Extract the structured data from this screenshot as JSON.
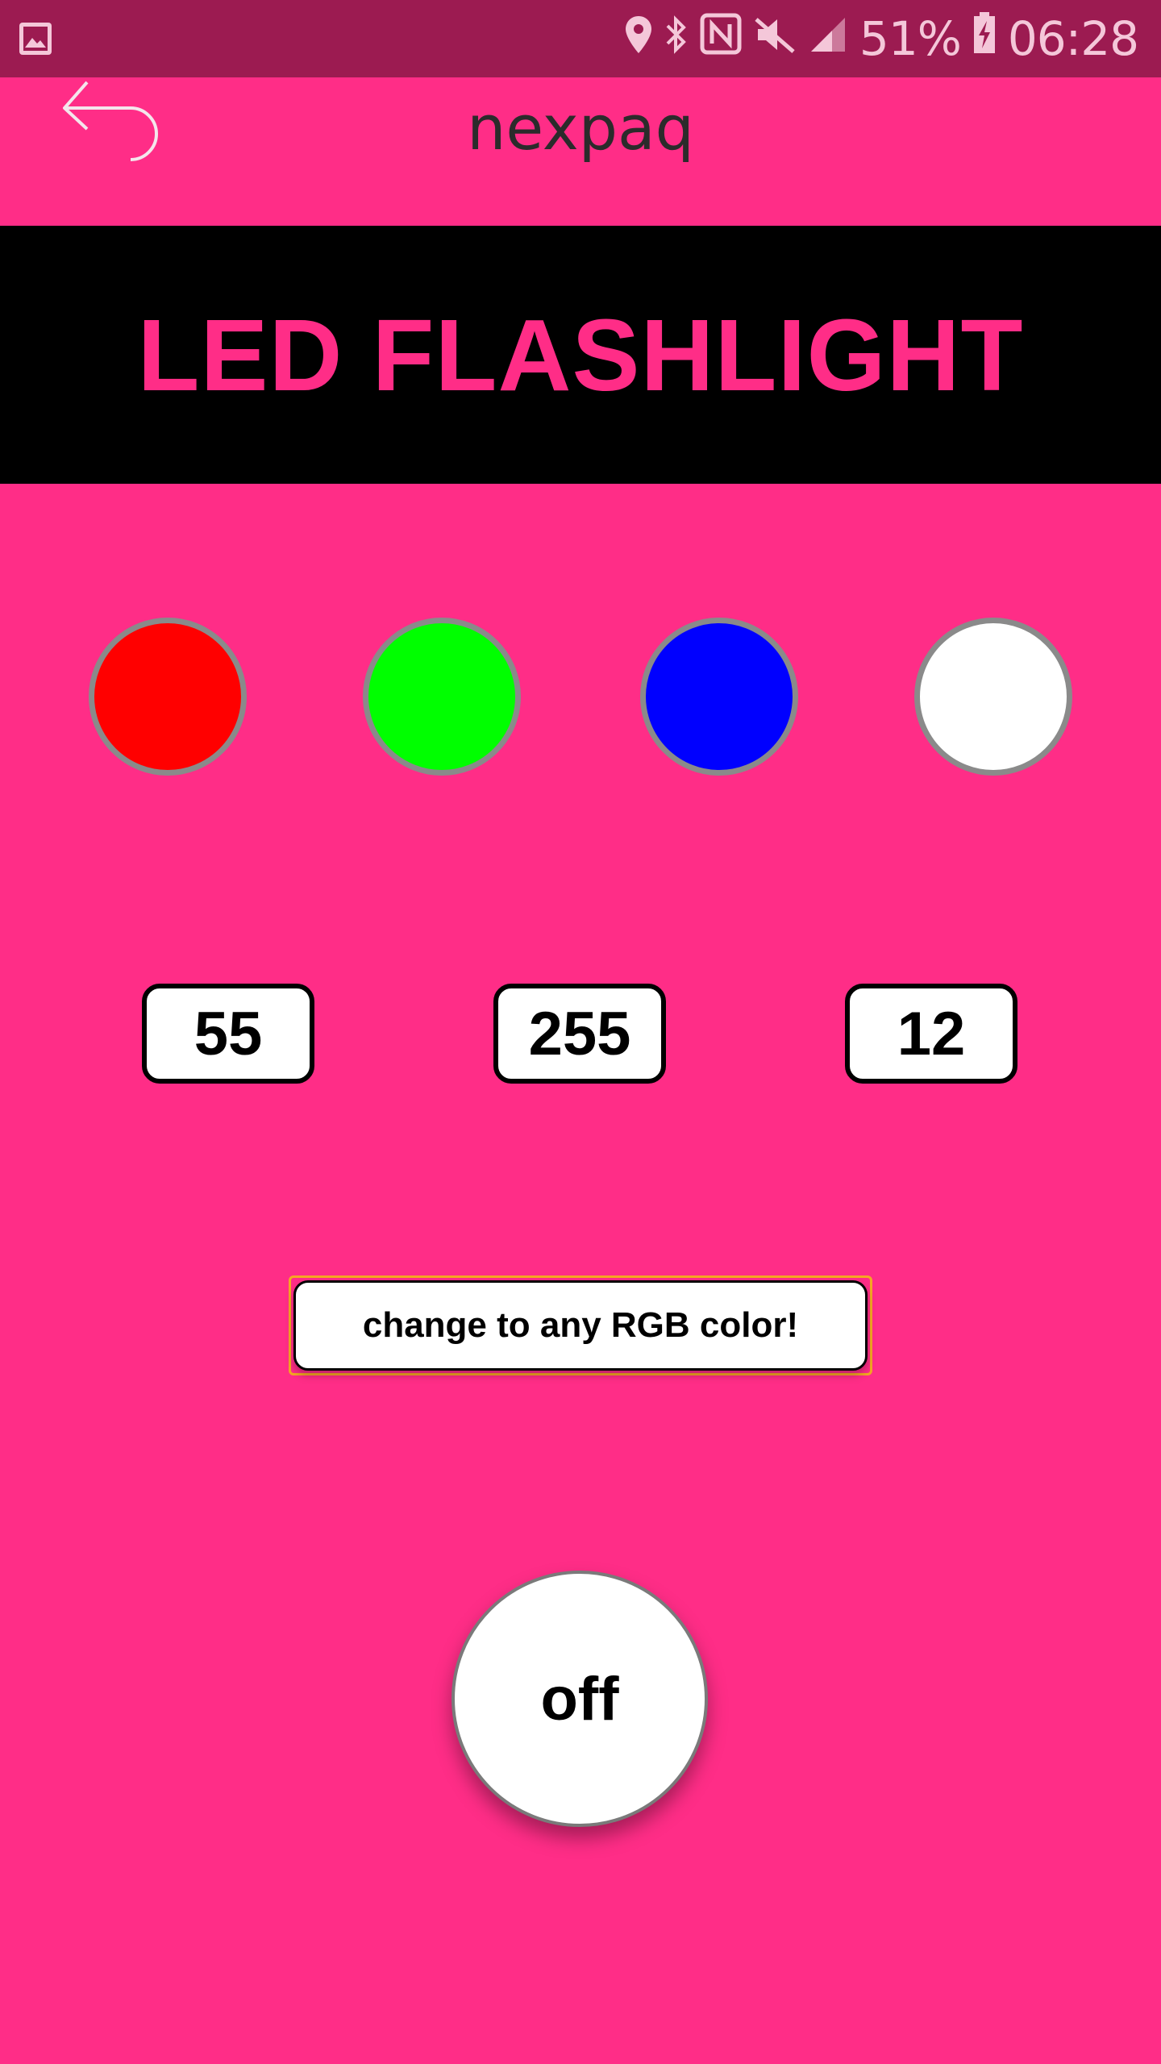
{
  "status_bar": {
    "battery": "51%",
    "time": "06:28",
    "icons": [
      "gallery-icon",
      "location-icon",
      "bluetooth-icon",
      "nfc-icon",
      "mute-icon",
      "signal-icon",
      "battery-charging-icon"
    ]
  },
  "header": {
    "title": "nexpaq",
    "back_icon": "back-arrow-icon"
  },
  "banner": {
    "title": "LED FLASHLIGHT"
  },
  "swatches": [
    {
      "name": "red",
      "color": "#FF0000"
    },
    {
      "name": "green",
      "color": "#00FF00"
    },
    {
      "name": "blue",
      "color": "#0000FF"
    },
    {
      "name": "white",
      "color": "#FFFFFF"
    }
  ],
  "rgb_values": {
    "r": "55",
    "g": "255",
    "b": "12"
  },
  "rgb_button": {
    "label": "change to any RGB color!"
  },
  "power_button": {
    "label": "off"
  },
  "colors": {
    "background": "#FF2D87",
    "status_bar": "#9C1B51",
    "banner_bg": "#000000",
    "accent_border": "#F5A623"
  }
}
